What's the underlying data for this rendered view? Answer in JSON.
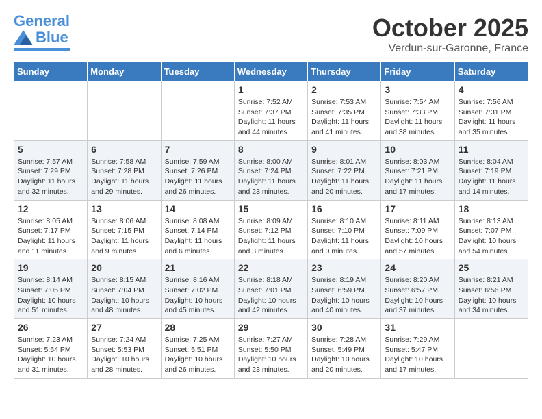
{
  "header": {
    "logo_line1": "General",
    "logo_line2": "Blue",
    "month": "October 2025",
    "location": "Verdun-sur-Garonne, France"
  },
  "weekdays": [
    "Sunday",
    "Monday",
    "Tuesday",
    "Wednesday",
    "Thursday",
    "Friday",
    "Saturday"
  ],
  "weeks": [
    [
      {
        "day": "",
        "info": ""
      },
      {
        "day": "",
        "info": ""
      },
      {
        "day": "",
        "info": ""
      },
      {
        "day": "1",
        "info": "Sunrise: 7:52 AM\nSunset: 7:37 PM\nDaylight: 11 hours\nand 44 minutes."
      },
      {
        "day": "2",
        "info": "Sunrise: 7:53 AM\nSunset: 7:35 PM\nDaylight: 11 hours\nand 41 minutes."
      },
      {
        "day": "3",
        "info": "Sunrise: 7:54 AM\nSunset: 7:33 PM\nDaylight: 11 hours\nand 38 minutes."
      },
      {
        "day": "4",
        "info": "Sunrise: 7:56 AM\nSunset: 7:31 PM\nDaylight: 11 hours\nand 35 minutes."
      }
    ],
    [
      {
        "day": "5",
        "info": "Sunrise: 7:57 AM\nSunset: 7:29 PM\nDaylight: 11 hours\nand 32 minutes."
      },
      {
        "day": "6",
        "info": "Sunrise: 7:58 AM\nSunset: 7:28 PM\nDaylight: 11 hours\nand 29 minutes."
      },
      {
        "day": "7",
        "info": "Sunrise: 7:59 AM\nSunset: 7:26 PM\nDaylight: 11 hours\nand 26 minutes."
      },
      {
        "day": "8",
        "info": "Sunrise: 8:00 AM\nSunset: 7:24 PM\nDaylight: 11 hours\nand 23 minutes."
      },
      {
        "day": "9",
        "info": "Sunrise: 8:01 AM\nSunset: 7:22 PM\nDaylight: 11 hours\nand 20 minutes."
      },
      {
        "day": "10",
        "info": "Sunrise: 8:03 AM\nSunset: 7:21 PM\nDaylight: 11 hours\nand 17 minutes."
      },
      {
        "day": "11",
        "info": "Sunrise: 8:04 AM\nSunset: 7:19 PM\nDaylight: 11 hours\nand 14 minutes."
      }
    ],
    [
      {
        "day": "12",
        "info": "Sunrise: 8:05 AM\nSunset: 7:17 PM\nDaylight: 11 hours\nand 11 minutes."
      },
      {
        "day": "13",
        "info": "Sunrise: 8:06 AM\nSunset: 7:15 PM\nDaylight: 11 hours\nand 9 minutes."
      },
      {
        "day": "14",
        "info": "Sunrise: 8:08 AM\nSunset: 7:14 PM\nDaylight: 11 hours\nand 6 minutes."
      },
      {
        "day": "15",
        "info": "Sunrise: 8:09 AM\nSunset: 7:12 PM\nDaylight: 11 hours\nand 3 minutes."
      },
      {
        "day": "16",
        "info": "Sunrise: 8:10 AM\nSunset: 7:10 PM\nDaylight: 11 hours\nand 0 minutes."
      },
      {
        "day": "17",
        "info": "Sunrise: 8:11 AM\nSunset: 7:09 PM\nDaylight: 10 hours\nand 57 minutes."
      },
      {
        "day": "18",
        "info": "Sunrise: 8:13 AM\nSunset: 7:07 PM\nDaylight: 10 hours\nand 54 minutes."
      }
    ],
    [
      {
        "day": "19",
        "info": "Sunrise: 8:14 AM\nSunset: 7:05 PM\nDaylight: 10 hours\nand 51 minutes."
      },
      {
        "day": "20",
        "info": "Sunrise: 8:15 AM\nSunset: 7:04 PM\nDaylight: 10 hours\nand 48 minutes."
      },
      {
        "day": "21",
        "info": "Sunrise: 8:16 AM\nSunset: 7:02 PM\nDaylight: 10 hours\nand 45 minutes."
      },
      {
        "day": "22",
        "info": "Sunrise: 8:18 AM\nSunset: 7:01 PM\nDaylight: 10 hours\nand 42 minutes."
      },
      {
        "day": "23",
        "info": "Sunrise: 8:19 AM\nSunset: 6:59 PM\nDaylight: 10 hours\nand 40 minutes."
      },
      {
        "day": "24",
        "info": "Sunrise: 8:20 AM\nSunset: 6:57 PM\nDaylight: 10 hours\nand 37 minutes."
      },
      {
        "day": "25",
        "info": "Sunrise: 8:21 AM\nSunset: 6:56 PM\nDaylight: 10 hours\nand 34 minutes."
      }
    ],
    [
      {
        "day": "26",
        "info": "Sunrise: 7:23 AM\nSunset: 5:54 PM\nDaylight: 10 hours\nand 31 minutes."
      },
      {
        "day": "27",
        "info": "Sunrise: 7:24 AM\nSunset: 5:53 PM\nDaylight: 10 hours\nand 28 minutes."
      },
      {
        "day": "28",
        "info": "Sunrise: 7:25 AM\nSunset: 5:51 PM\nDaylight: 10 hours\nand 26 minutes."
      },
      {
        "day": "29",
        "info": "Sunrise: 7:27 AM\nSunset: 5:50 PM\nDaylight: 10 hours\nand 23 minutes."
      },
      {
        "day": "30",
        "info": "Sunrise: 7:28 AM\nSunset: 5:49 PM\nDaylight: 10 hours\nand 20 minutes."
      },
      {
        "day": "31",
        "info": "Sunrise: 7:29 AM\nSunset: 5:47 PM\nDaylight: 10 hours\nand 17 minutes."
      },
      {
        "day": "",
        "info": ""
      }
    ]
  ]
}
